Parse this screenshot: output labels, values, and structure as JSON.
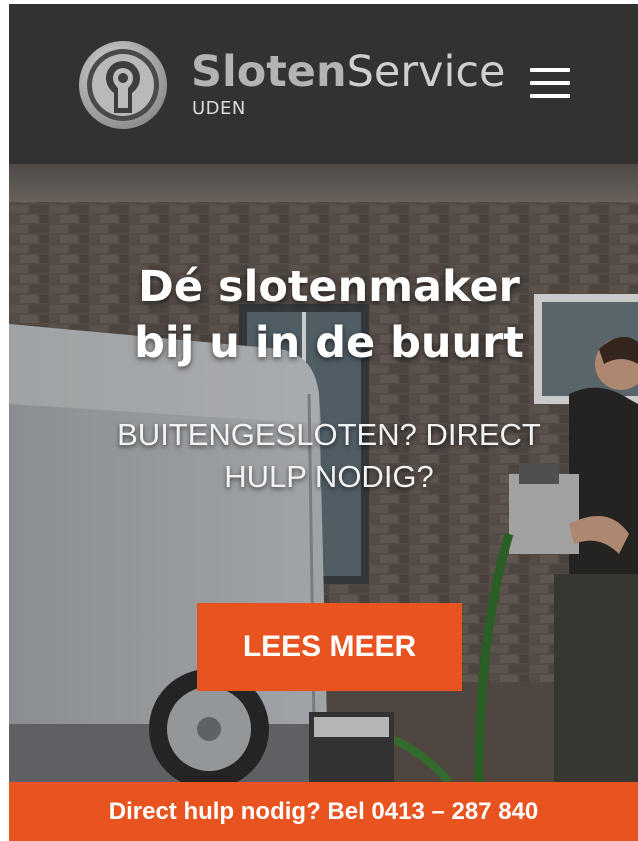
{
  "header": {
    "brand_bold": "Sloten",
    "brand_light": "Service",
    "brand_location": "UDEN",
    "logo_icon": "keyhole-icon",
    "menu_icon": "hamburger-menu-icon",
    "background": "#343231"
  },
  "hero": {
    "headline_line1": "Dé slotenmaker",
    "headline_line2": "bij u in de buurt",
    "subheadline_line1": "BUITENGESLOTEN? DIRECT",
    "subheadline_line2": "HULP NODIG?",
    "cta_label": "LEES MEER"
  },
  "callbar": {
    "text": "Direct hulp nodig? Bel 0413 – 287 840"
  },
  "colors": {
    "accent": "#e8531f",
    "header_bg": "#343231",
    "text_light": "#ffffff"
  }
}
